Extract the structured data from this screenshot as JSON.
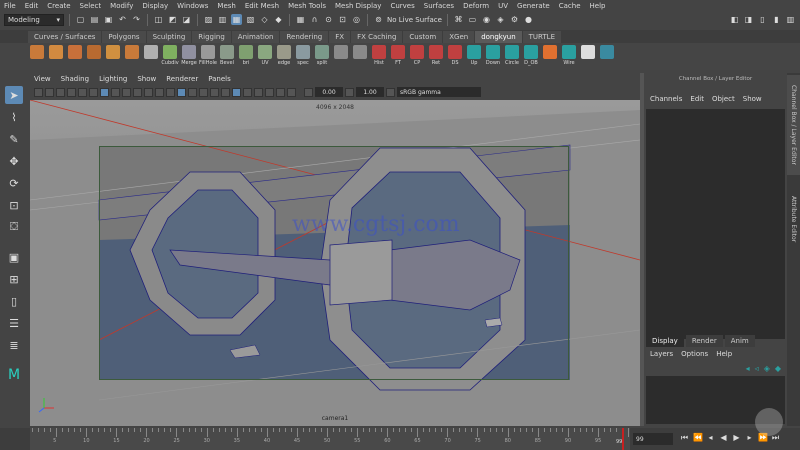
{
  "menu": [
    "File",
    "Edit",
    "Create",
    "Select",
    "Modify",
    "Display",
    "Windows",
    "Mesh",
    "Edit Mesh",
    "Mesh Tools",
    "Mesh Display",
    "Curves",
    "Surfaces",
    "Deform",
    "UV",
    "Generate",
    "Cache",
    "Help"
  ],
  "status": {
    "mode": "Modeling",
    "live_surface": "No Live Surface"
  },
  "shelf_tabs": [
    {
      "label": "Curves / Surfaces",
      "active": false
    },
    {
      "label": "Polygons",
      "active": false
    },
    {
      "label": "Sculpting",
      "active": false
    },
    {
      "label": "Rigging",
      "active": false
    },
    {
      "label": "Animation",
      "active": false
    },
    {
      "label": "Rendering",
      "active": false
    },
    {
      "label": "FX",
      "active": false
    },
    {
      "label": "FX Caching",
      "active": false
    },
    {
      "label": "Custom",
      "active": false
    },
    {
      "label": "XGen",
      "active": false
    },
    {
      "label": "dongkyun",
      "active": true
    },
    {
      "label": "TURTLE",
      "active": false
    }
  ],
  "shelf_icons": [
    {
      "label": "",
      "color": "#c87a3a"
    },
    {
      "label": "",
      "color": "#d28a40"
    },
    {
      "label": "",
      "color": "#c8703a"
    },
    {
      "label": "",
      "color": "#b86a30"
    },
    {
      "label": "",
      "color": "#d09040"
    },
    {
      "label": "",
      "color": "#c87a3a"
    },
    {
      "label": "",
      "color": "#b0b0b0"
    },
    {
      "label": "Cubdiv",
      "color": "#7fb060"
    },
    {
      "label": "Merge",
      "color": "#9090a0"
    },
    {
      "label": "FillHole",
      "color": "#9a9a9a"
    },
    {
      "label": "Bevel",
      "color": "#8a9a8a"
    },
    {
      "label": "bri",
      "color": "#7fa070"
    },
    {
      "label": "UV",
      "color": "#8aa880"
    },
    {
      "label": "edge",
      "color": "#9a9a8a"
    },
    {
      "label": "spec",
      "color": "#8a9aa0"
    },
    {
      "label": "split",
      "color": "#7a9a8a"
    },
    {
      "label": "",
      "color": "#8a8a8a"
    },
    {
      "label": "",
      "color": "#8a8a8a"
    },
    {
      "label": "Hist",
      "color": "#c04040"
    },
    {
      "label": "FT",
      "color": "#c04040"
    },
    {
      "label": "CP",
      "color": "#c04040"
    },
    {
      "label": "Ret",
      "color": "#c04040"
    },
    {
      "label": "DS",
      "color": "#c04040"
    },
    {
      "label": "Up",
      "color": "#2aa0a0"
    },
    {
      "label": "Down",
      "color": "#2aa0a0"
    },
    {
      "label": "Circle",
      "color": "#2aa0a0"
    },
    {
      "label": "D_OB",
      "color": "#2aa0a0"
    },
    {
      "label": "",
      "color": "#e07030"
    },
    {
      "label": "Wire",
      "color": "#2aa0a0"
    },
    {
      "label": "",
      "color": "#dddddd"
    },
    {
      "label": "",
      "color": "#3a8aa0"
    }
  ],
  "panel_menu": [
    "View",
    "Shading",
    "Lighting",
    "Show",
    "Renderer",
    "Panels"
  ],
  "panel_toolbar": {
    "exposure": "0.00",
    "gamma": "1.00",
    "color_space": "sRGB gamma"
  },
  "viewport": {
    "resolution": "4096 x 2048",
    "camera": "camera1",
    "watermark": "www.cgtsj.com"
  },
  "channel_box": {
    "title": "Channel Box / Layer Editor",
    "menu": [
      "Channels",
      "Edit",
      "Object",
      "Show"
    ],
    "layer_tabs": [
      {
        "label": "Display",
        "active": true
      },
      {
        "label": "Render",
        "active": false
      },
      {
        "label": "Anim",
        "active": false
      }
    ],
    "layer_menu": [
      "Layers",
      "Options",
      "Help"
    ]
  },
  "side_tabs": [
    "Channel Box / Layer Editor",
    "Attribute Editor"
  ],
  "timeline": {
    "ticks": [
      "5",
      "10",
      "15",
      "20",
      "25",
      "30",
      "35",
      "40",
      "45",
      "50",
      "55",
      "60",
      "65",
      "70",
      "75",
      "80",
      "85",
      "90",
      "95"
    ],
    "current_frame": "99",
    "end_frame": "99"
  }
}
